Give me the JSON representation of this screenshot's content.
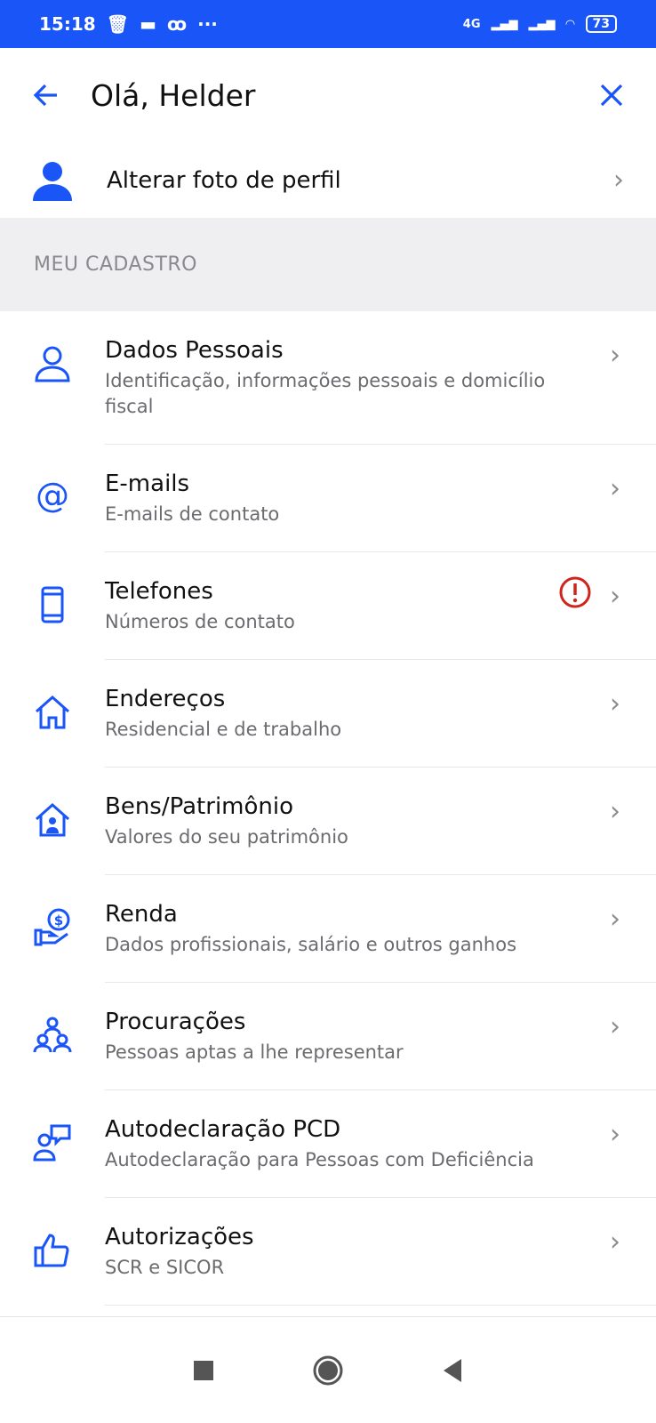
{
  "status_bar": {
    "time": "15:18",
    "network": "4G",
    "battery": "73"
  },
  "header": {
    "title": "Olá, Helder"
  },
  "profile": {
    "label": "Alterar foto de perfil"
  },
  "section": {
    "title": "MEU CADASTRO"
  },
  "items": [
    {
      "title": "Dados Pessoais",
      "subtitle": "Identificação, informações pessoais e domicílio fiscal"
    },
    {
      "title": "E-mails",
      "subtitle": "E-mails de contato"
    },
    {
      "title": "Telefones",
      "subtitle": "Números de contato"
    },
    {
      "title": "Endereços",
      "subtitle": "Residencial e de trabalho"
    },
    {
      "title": "Bens/Patrimônio",
      "subtitle": "Valores do seu patrimônio"
    },
    {
      "title": "Renda",
      "subtitle": "Dados profissionais, salário e outros ganhos"
    },
    {
      "title": "Procurações",
      "subtitle": "Pessoas aptas a lhe representar"
    },
    {
      "title": "Autodeclaração PCD",
      "subtitle": "Autodeclaração para Pessoas com Deficiência"
    },
    {
      "title": "Autorizações",
      "subtitle": "SCR e SICOR"
    }
  ],
  "colors": {
    "accent": "#1a55f8",
    "warning": "#d0241b"
  }
}
